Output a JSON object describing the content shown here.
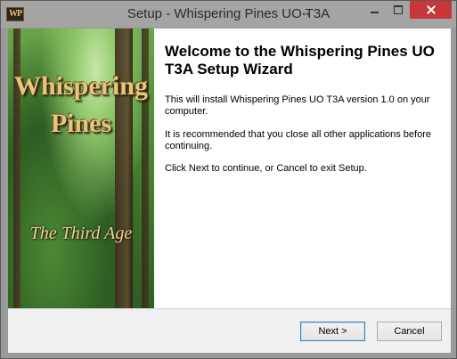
{
  "window": {
    "title": "Setup - Whispering Pines UO T3A",
    "app_icon_text": "WP",
    "controls": [
      "minimize",
      "maximize",
      "close"
    ],
    "colors": {
      "close_button": "#c7373a",
      "titlebar": "#a4a4a4"
    }
  },
  "banner": {
    "title_line1": "Whispering",
    "title_line2": "Pines",
    "subtitle": "The Third Age"
  },
  "content": {
    "heading": "Welcome to the Whispering Pines UO T3A Setup Wizard",
    "paragraph1": "This will install Whispering Pines UO T3A version 1.0 on your computer.",
    "paragraph2": "It is recommended that you close all other applications before continuing.",
    "paragraph3": "Click Next to continue, or Cancel to exit Setup."
  },
  "buttons": {
    "next": "Next >",
    "cancel": "Cancel"
  }
}
